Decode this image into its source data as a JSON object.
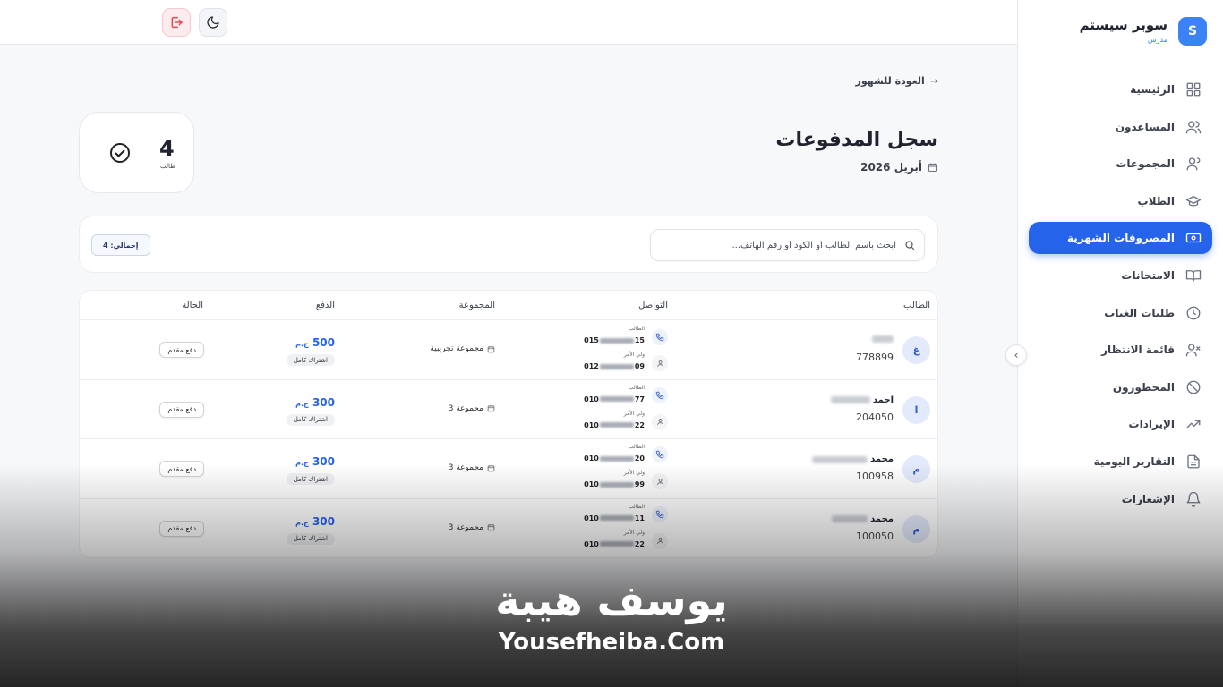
{
  "brand": {
    "logo_letter": "S",
    "title": "سوبر سيستم",
    "subtitle": "مدرس"
  },
  "nav": [
    {
      "label": "الرئيسية",
      "icon": "grid-icon",
      "active": false
    },
    {
      "label": "المساعدون",
      "icon": "users-icon",
      "active": false
    },
    {
      "label": "المجموعات",
      "icon": "group-icon",
      "active": false
    },
    {
      "label": "الطلاب",
      "icon": "graduation-cap-icon",
      "active": false
    },
    {
      "label": "المصروفات الشهرية",
      "icon": "banknote-icon",
      "active": true
    },
    {
      "label": "الامتحانات",
      "icon": "book-icon",
      "active": false
    },
    {
      "label": "طلبات الغياب",
      "icon": "clock-icon",
      "active": false
    },
    {
      "label": "قائمة الانتظار",
      "icon": "user-x-icon",
      "active": false
    },
    {
      "label": "المحظورون",
      "icon": "ban-icon",
      "active": false
    },
    {
      "label": "الإيرادات",
      "icon": "trending-up-icon",
      "active": false
    },
    {
      "label": "التقارير اليومية",
      "icon": "file-text-icon",
      "active": false
    },
    {
      "label": "الإشعارات",
      "icon": "bell-icon",
      "active": false
    }
  ],
  "page": {
    "back_label": "العودة للشهور",
    "title": "سجل المدفوعات",
    "date": "أبريل 2026"
  },
  "stat": {
    "value": "4",
    "label": "طالب"
  },
  "search": {
    "placeholder": "ابحث باسم الطالب أو الكود أو رقم الهاتف..."
  },
  "total_badge": "إجمالي: 4",
  "table": {
    "headers": {
      "student": "الطالب",
      "contact": "التواصل",
      "group": "المجموعة",
      "payment": "الدفع",
      "status": "الحالة"
    },
    "contact_labels": {
      "student": "الطالب",
      "parent": "ولي الأمر"
    },
    "currency": "ج.م",
    "rows": [
      {
        "initial": "غ",
        "name": "",
        "code": "778899",
        "student_phone_start": "015",
        "student_phone_end": "15",
        "parent_phone_start": "012",
        "parent_phone_end": "09",
        "group": "مجموعة تجريبية",
        "amount": "500",
        "pay_type": "اشتراك كامل",
        "status": "دفع مقدم"
      },
      {
        "initial": "ا",
        "name": "احمد",
        "code": "204050",
        "student_phone_start": "010",
        "student_phone_end": "77",
        "parent_phone_start": "010",
        "parent_phone_end": "22",
        "group": "مجموعة 3",
        "amount": "300",
        "pay_type": "اشتراك كامل",
        "status": "دفع مقدم"
      },
      {
        "initial": "م",
        "name": "محمد",
        "code": "100958",
        "student_phone_start": "010",
        "student_phone_end": "20",
        "parent_phone_start": "010",
        "parent_phone_end": "99",
        "group": "مجموعة 3",
        "amount": "300",
        "pay_type": "اشتراك كامل",
        "status": "دفع مقدم"
      },
      {
        "initial": "م",
        "name": "محمد",
        "code": "100050",
        "student_phone_start": "010",
        "student_phone_end": "11",
        "parent_phone_start": "010",
        "parent_phone_end": "22",
        "group": "مجموعة 3",
        "amount": "300",
        "pay_type": "اشتراك كامل",
        "status": "دفع مقدم"
      }
    ]
  },
  "watermark": {
    "name": "يوسف هيبة",
    "site": "Yousefheiba.Com"
  },
  "colors": {
    "accent": "#2563eb",
    "logout": "#e5484d"
  }
}
